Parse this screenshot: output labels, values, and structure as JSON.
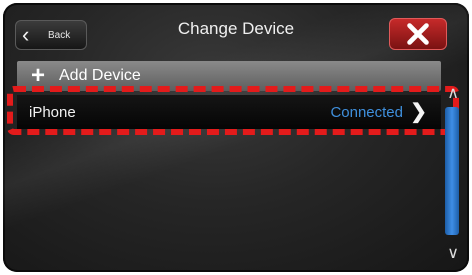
{
  "header": {
    "back_label": "Back",
    "title": "Change Device"
  },
  "add_device": {
    "label": "Add Device"
  },
  "devices": [
    {
      "name": "iPhone",
      "status": "Connected"
    }
  ],
  "colors": {
    "status_connected": "#3f8fdc",
    "close_button": "#c62a2a",
    "highlight": "#e31b1b",
    "scrollbar": "#3e8ee6"
  },
  "icons": {
    "back": "chevron-left-icon",
    "close": "close-icon",
    "add": "plus-icon",
    "row": "chevron-right-icon",
    "scroll_up": "chevron-up-icon",
    "scroll_down": "chevron-down-icon"
  }
}
